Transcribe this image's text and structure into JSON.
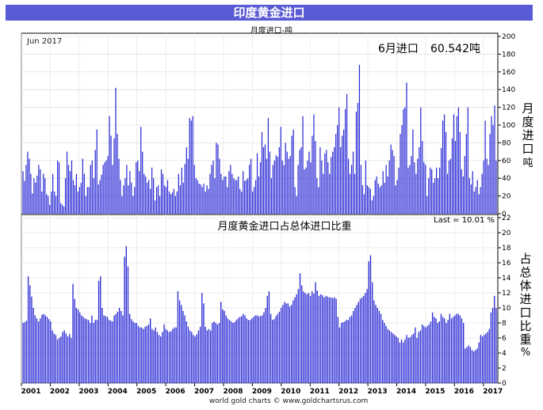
{
  "header": {
    "title": "印度黄金进口",
    "subtitle": "月度进口-吨"
  },
  "top_panel": {
    "date_label": "Jun 2017",
    "latest_label": "6月进口",
    "latest_value": "60.542吨",
    "ylabel_chars": [
      "月",
      "度",
      "进",
      "口",
      "吨"
    ]
  },
  "bottom_panel": {
    "title": "月度黄金进口占总体进口比重",
    "last_label": "Last = 10.01 %",
    "ylabel_chars": [
      "占",
      "总",
      "体",
      "进",
      "口",
      "比",
      "重",
      "%"
    ]
  },
  "footer": {
    "credit": "world gold charts © www.goldchartsrus.com"
  },
  "colors": {
    "bar": "#2b2bd6",
    "bar_edge": "#10107a",
    "title_bg": "#5a5ad4"
  },
  "chart_data": [
    {
      "type": "bar",
      "title": "月度进口-吨",
      "ylabel": "月度进口吨",
      "x_start": "2001-01",
      "x_end": "2017-06",
      "x_ticks": [
        "2001",
        "2002",
        "2003",
        "2004",
        "2005",
        "2006",
        "2007",
        "2008",
        "2009",
        "2010",
        "2011",
        "2012",
        "2013",
        "2014",
        "2015",
        "2016",
        "2017"
      ],
      "ylim": [
        0,
        200
      ],
      "yticks": [
        0,
        20,
        40,
        60,
        80,
        100,
        120,
        140,
        160,
        180,
        200
      ],
      "values": [
        48,
        37,
        55,
        70,
        62,
        45,
        23,
        40,
        35,
        43,
        55,
        50,
        25,
        45,
        40,
        22,
        20,
        10,
        25,
        45,
        25,
        20,
        60,
        58,
        12,
        10,
        8,
        40,
        70,
        55,
        48,
        60,
        38,
        32,
        45,
        25,
        30,
        35,
        62,
        45,
        20,
        30,
        30,
        55,
        60,
        40,
        72,
        95,
        33,
        38,
        44,
        55,
        58,
        60,
        65,
        110,
        88,
        55,
        85,
        142,
        90,
        62,
        38,
        20,
        32,
        40,
        55,
        32,
        48,
        35,
        20,
        30,
        58,
        60,
        48,
        98,
        70,
        45,
        42,
        35,
        38,
        28,
        52,
        40,
        15,
        30,
        32,
        20,
        50,
        45,
        32,
        30,
        38,
        25,
        22,
        24,
        28,
        20,
        25,
        45,
        32,
        52,
        35,
        56,
        75,
        62,
        108,
        105,
        110,
        55,
        40,
        38,
        34,
        33,
        30,
        34,
        25,
        32,
        28,
        45,
        55,
        60,
        40,
        80,
        78,
        62,
        45,
        38,
        42,
        42,
        30,
        48,
        55,
        45,
        40,
        38,
        38,
        42,
        28,
        25,
        48,
        37,
        38,
        40,
        55,
        62,
        25,
        30,
        38,
        68,
        42,
        58,
        92,
        75,
        78,
        62,
        108,
        70,
        40,
        55,
        60,
        66,
        64,
        75,
        98,
        60,
        55,
        80,
        70,
        62,
        65,
        88,
        95,
        30,
        20,
        55,
        72,
        75,
        110,
        50,
        52,
        60,
        70,
        58,
        88,
        112,
        82,
        40,
        30,
        75,
        60,
        45,
        68,
        72,
        58,
        45,
        64,
        70,
        75,
        90,
        100,
        120,
        75,
        88,
        95,
        118,
        135,
        62,
        45,
        55,
        70,
        45,
        115,
        125,
        168,
        55,
        32,
        22,
        60,
        32,
        30,
        28,
        15,
        20,
        38,
        42,
        34,
        30,
        32,
        48,
        35,
        55,
        42,
        60,
        78,
        72,
        65,
        32,
        38,
        52,
        90,
        100,
        118,
        120,
        148,
        52,
        55,
        65,
        95,
        58,
        45,
        62,
        75,
        120,
        82,
        58,
        55,
        20,
        40,
        52,
        50,
        35,
        40,
        52,
        40,
        52,
        74,
        105,
        112,
        92,
        45,
        60,
        62,
        85,
        112,
        82,
        110,
        120,
        92,
        50,
        42,
        65,
        90,
        120,
        40,
        33,
        48,
        25,
        30,
        38,
        22,
        30,
        45,
        60,
        105,
        62,
        55,
        90,
        110,
        100,
        122,
        60
      ]
    },
    {
      "type": "bar",
      "title": "月度黄金进口占总体进口比重",
      "ylabel": "占总体进口比重 %",
      "ylim": [
        0,
        22
      ],
      "yticks": [
        0,
        2,
        4,
        6,
        8,
        10,
        12,
        14,
        16,
        18,
        20,
        22
      ],
      "values": [
        8.0,
        8.1,
        8.3,
        14.2,
        13.0,
        11.5,
        10.0,
        9.0,
        8.6,
        8.2,
        8.6,
        9.1,
        9.2,
        9.0,
        8.8,
        8.5,
        8.2,
        7.0,
        6.6,
        6.4,
        5.8,
        6.0,
        6.2,
        6.8,
        7.0,
        6.6,
        6.2,
        6.5,
        6.0,
        13.2,
        11.2,
        10.0,
        9.8,
        9.4,
        9.0,
        8.8,
        8.6,
        8.5,
        8.4,
        8.0,
        9.0,
        8.0,
        8.4,
        8.4,
        13.6,
        14.2,
        10.0,
        9.0,
        8.9,
        8.8,
        8.4,
        8.3,
        8.2,
        9.0,
        9.2,
        9.5,
        10.0,
        9.6,
        9.0,
        16.8,
        18.2,
        15.5,
        9.2,
        8.5,
        8.2,
        8.0,
        8.0,
        7.6,
        7.4,
        7.4,
        7.2,
        7.5,
        7.6,
        7.8,
        8.6,
        7.2,
        7.0,
        7.4,
        6.8,
        6.4,
        6.2,
        6.8,
        7.8,
        7.2,
        7.0,
        6.8,
        6.9,
        7.2,
        7.4,
        7.4,
        12.2,
        11.0,
        10.4,
        9.6,
        9.0,
        8.2,
        7.5,
        7.0,
        6.8,
        6.4,
        6.2,
        6.5,
        7.0,
        7.5,
        12.0,
        10.6,
        7.5,
        7.0,
        7.2,
        7.0,
        8.0,
        8.2,
        8.0,
        7.8,
        8.0,
        10.8,
        9.8,
        9.6,
        9.0,
        8.6,
        8.4,
        8.2,
        8.0,
        8.1,
        8.4,
        8.6,
        8.8,
        8.9,
        9.2,
        9.0,
        8.6,
        8.4,
        8.4,
        8.6,
        8.8,
        9.0,
        9.0,
        8.9,
        8.9,
        9.0,
        9.4,
        10.0,
        11.6,
        12.2,
        9.2,
        8.4,
        8.5,
        8.9,
        9.2,
        9.5,
        10.0,
        10.4,
        10.8,
        10.6,
        10.6,
        10.2,
        10.4,
        11.0,
        11.4,
        11.8,
        12.5,
        14.6,
        13.0,
        12.2,
        12.0,
        11.8,
        12.0,
        11.6,
        12.2,
        11.9,
        13.4,
        12.3,
        11.6,
        11.8,
        11.7,
        11.4,
        11.6,
        11.5,
        11.4,
        11.4,
        11.3,
        11.4,
        11.2,
        8.8,
        7.4,
        8.0,
        8.1,
        8.2,
        8.4,
        8.4,
        8.8,
        9.0,
        9.6,
        10.0,
        10.4,
        10.8,
        11.2,
        11.4,
        11.6,
        12.0,
        12.5,
        16.2,
        17.0,
        13.4,
        11.0,
        10.4,
        10.0,
        9.6,
        9.2,
        8.4,
        8.0,
        7.6,
        7.2,
        7.0,
        6.8,
        6.6,
        6.4,
        6.2,
        6.0,
        5.4,
        5.8,
        5.4,
        5.8,
        6.4,
        6.0,
        6.1,
        6.4,
        6.6,
        7.4,
        6.0,
        6.8,
        7.0,
        7.8,
        7.6,
        7.4,
        7.6,
        7.8,
        8.2,
        9.4,
        8.8,
        8.6,
        8.0,
        8.2,
        9.2,
        8.8,
        8.6,
        8.0,
        8.4,
        9.2,
        8.6,
        8.8,
        9.0,
        9.2,
        9.2,
        9.0,
        8.6,
        8.0,
        4.6,
        4.8,
        5.0,
        4.8,
        4.4,
        4.2,
        4.4,
        4.6,
        5.4,
        6.4,
        6.2,
        6.4,
        6.6,
        6.8,
        7.2,
        9.4,
        10.0,
        11.6,
        10.0
      ]
    }
  ]
}
